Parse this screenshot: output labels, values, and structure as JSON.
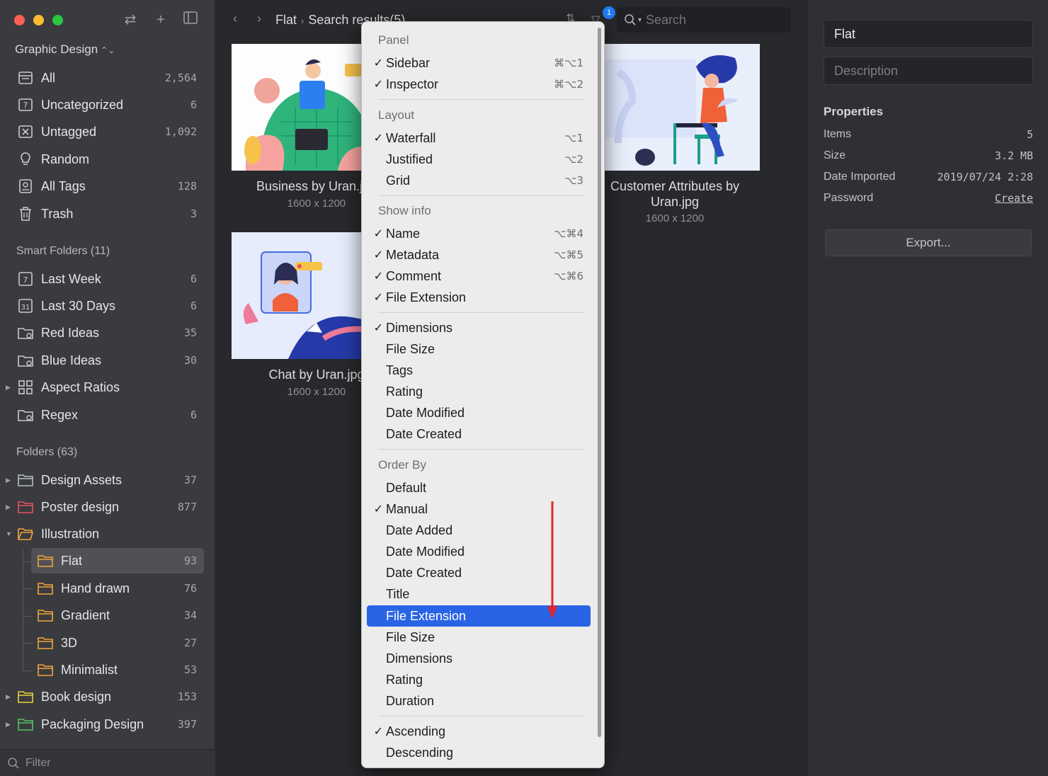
{
  "window": {
    "sidebar_title": "Graphic Design"
  },
  "sidebar": {
    "library": [
      {
        "icon": "inbox-icon",
        "label": "All",
        "count": "2,564"
      },
      {
        "icon": "question-icon",
        "label": "Uncategorized",
        "count": "6"
      },
      {
        "icon": "untagged-icon",
        "label": "Untagged",
        "count": "1,092"
      },
      {
        "icon": "bulb-icon",
        "label": "Random",
        "count": ""
      },
      {
        "icon": "tag-icon",
        "label": "All Tags",
        "count": "128"
      },
      {
        "icon": "trash-icon",
        "label": "Trash",
        "count": "3"
      }
    ],
    "smart_folders_header": "Smart Folders (11)",
    "smart_folders": [
      {
        "icon": "calendar-7-icon",
        "label": "Last Week",
        "count": "6"
      },
      {
        "icon": "calendar-31-icon",
        "label": "Last 30 Days",
        "count": "6"
      },
      {
        "icon": "smart-folder-icon",
        "label": "Red Ideas",
        "count": "35"
      },
      {
        "icon": "smart-folder-icon",
        "label": "Blue Ideas",
        "count": "30"
      },
      {
        "icon": "grid-icon",
        "label": "Aspect Ratios",
        "count": ""
      },
      {
        "icon": "smart-folder-icon",
        "label": "Regex",
        "count": "6"
      }
    ],
    "folders_header": "Folders (63)",
    "folders": [
      {
        "label": "Design Assets",
        "count": "37",
        "color": "#b7bdc6"
      },
      {
        "label": "Poster design",
        "count": "877",
        "color": "#e8505b"
      },
      {
        "label": "Illustration",
        "count": "",
        "color": "#f2a53a"
      },
      {
        "label": "Flat",
        "count": "93",
        "color": "#f2a53a"
      },
      {
        "label": "Hand drawn",
        "count": "76",
        "color": "#f2a53a"
      },
      {
        "label": "Gradient",
        "count": "34",
        "color": "#f2a53a"
      },
      {
        "label": "3D",
        "count": "27",
        "color": "#f2a53a"
      },
      {
        "label": "Minimalist",
        "count": "53",
        "color": "#f2a53a"
      },
      {
        "label": "Book design",
        "count": "153",
        "color": "#e7d23c"
      },
      {
        "label": "Packaging Design",
        "count": "397",
        "color": "#58c462"
      }
    ],
    "filter_placeholder": "Filter"
  },
  "toolbar": {
    "breadcrumb_folder": "Flat",
    "breadcrumb_current": "Search results(5)",
    "filter_badge": "1",
    "search_placeholder": "Search"
  },
  "cards": [
    {
      "title": "Business by Uran.jpg",
      "dims": "1600 x 1200"
    },
    {
      "title": "Customer Attributes by Uran.jpg",
      "dims": "1600 x 1200"
    },
    {
      "title": "Chat by Uran.jpg",
      "dims": "1600 x 1200"
    }
  ],
  "inspector": {
    "name_value": "Flat",
    "description_placeholder": "Description",
    "properties_header": "Properties",
    "items_label": "Items",
    "items_value": "5",
    "size_label": "Size",
    "size_value": "3.2 MB",
    "date_label": "Date Imported",
    "date_value": "2019/07/24 2:28",
    "password_label": "Password",
    "password_value": "Create",
    "export_label": "Export..."
  },
  "menu": {
    "panel_header": "Panel",
    "sidebar": {
      "label": "Sidebar",
      "shortcut": "⌘⌥1",
      "checked": true
    },
    "inspector": {
      "label": "Inspector",
      "shortcut": "⌘⌥2",
      "checked": true
    },
    "layout_header": "Layout",
    "waterfall": {
      "label": "Waterfall",
      "shortcut": "⌥1",
      "checked": true
    },
    "justified": {
      "label": "Justified",
      "shortcut": "⌥2",
      "checked": false
    },
    "grid": {
      "label": "Grid",
      "shortcut": "⌥3",
      "checked": false
    },
    "showinfo_header": "Show info",
    "name": {
      "label": "Name",
      "shortcut": "⌥⌘4",
      "checked": true
    },
    "metadata": {
      "label": "Metadata",
      "shortcut": "⌥⌘5",
      "checked": true
    },
    "comment": {
      "label": "Comment",
      "shortcut": "⌥⌘6",
      "checked": true
    },
    "file_extension": {
      "label": "File Extension",
      "checked": true
    },
    "dimensions": {
      "label": "Dimensions",
      "checked": true
    },
    "file_size": {
      "label": "File Size"
    },
    "tags": {
      "label": "Tags"
    },
    "rating": {
      "label": "Rating"
    },
    "date_modified": {
      "label": "Date Modified"
    },
    "date_created": {
      "label": "Date Created"
    },
    "orderby_header": "Order By",
    "o_default": {
      "label": "Default"
    },
    "o_manual": {
      "label": "Manual",
      "checked": true
    },
    "o_date_added": {
      "label": "Date Added"
    },
    "o_date_modified": {
      "label": "Date Modified"
    },
    "o_date_created": {
      "label": "Date Created"
    },
    "o_title": {
      "label": "Title"
    },
    "o_file_extension": {
      "label": "File Extension",
      "highlighted": true
    },
    "o_file_size": {
      "label": "File Size"
    },
    "o_dimensions": {
      "label": "Dimensions"
    },
    "o_rating": {
      "label": "Rating"
    },
    "o_duration": {
      "label": "Duration"
    },
    "ascending": {
      "label": "Ascending",
      "checked": true
    },
    "descending": {
      "label": "Descending"
    },
    "check_glyph": "✓"
  },
  "colors": {
    "highlight": "#2a64e6",
    "badge": "#1f7cf2",
    "annotation_arrow": "#e0262b"
  }
}
